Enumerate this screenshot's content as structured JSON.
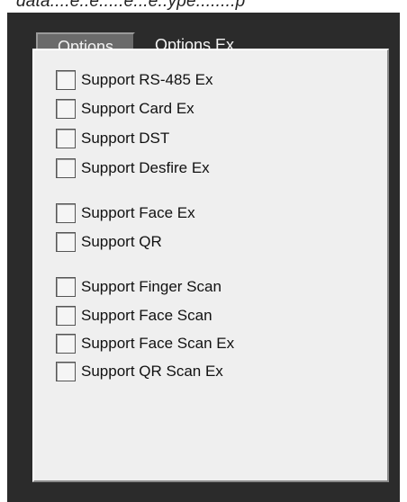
{
  "header_fragment": "data....e..e.....e...e..ype........p",
  "tabs": [
    {
      "label": "Options",
      "active": false
    },
    {
      "label": "Options Ex",
      "active": true
    }
  ],
  "checkboxes": [
    {
      "label": "Support RS-485 Ex",
      "checked": false
    },
    {
      "label": "Support Card Ex",
      "checked": false
    },
    {
      "label": "Support DST",
      "checked": false
    },
    {
      "label": "Support Desfire Ex",
      "checked": false
    },
    {
      "label": "Support Face Ex",
      "checked": false
    },
    {
      "label": "Support QR",
      "checked": false
    },
    {
      "label": "Support Finger Scan",
      "checked": false
    },
    {
      "label": "Support Face Scan",
      "checked": false
    },
    {
      "label": "Support Face Scan Ex",
      "checked": false
    },
    {
      "label": "Support QR Scan Ex",
      "checked": false
    }
  ]
}
